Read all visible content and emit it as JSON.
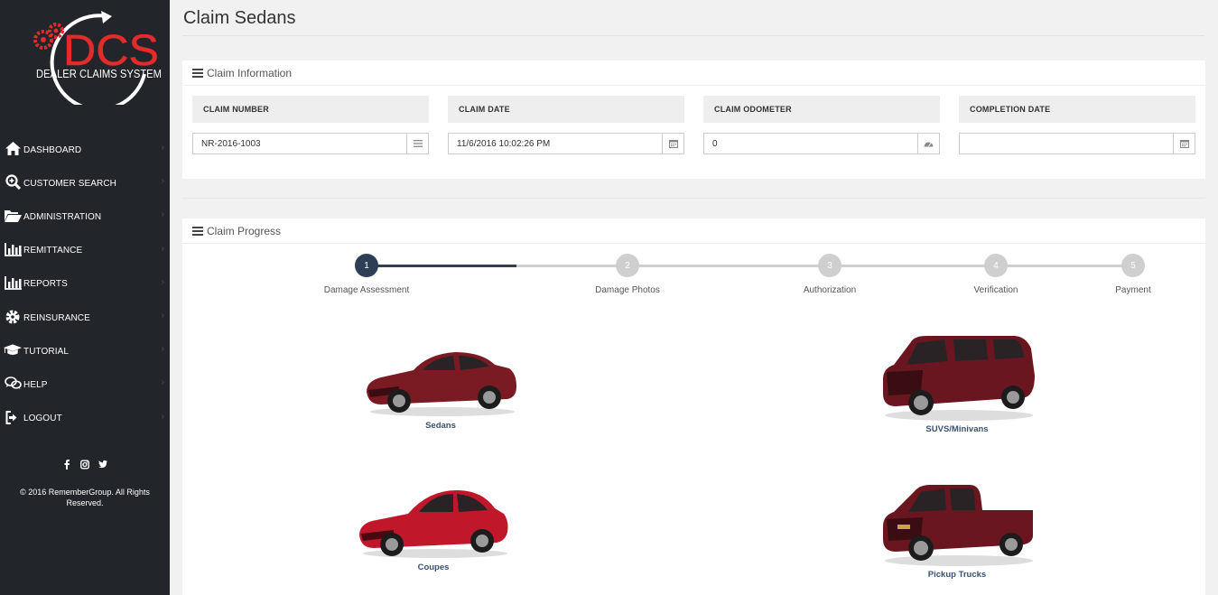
{
  "brand": {
    "logo_main": "DCS",
    "logo_sub": "DEALER CLAIMS SYSTEM",
    "accent_red": "#e32b2b"
  },
  "sidebar": {
    "items": [
      {
        "label": "DASHBOARD",
        "icon": "home-icon"
      },
      {
        "label": "CUSTOMER SEARCH",
        "icon": "search-plus-icon"
      },
      {
        "label": "ADMINISTRATION",
        "icon": "folder-open-icon"
      },
      {
        "label": "REMITTANCE",
        "icon": "bar-chart-icon"
      },
      {
        "label": "REPORTS",
        "icon": "bar-chart-icon"
      },
      {
        "label": "REINSURANCE",
        "icon": "gear-icon"
      },
      {
        "label": "TUTORIAL",
        "icon": "graduation-cap-icon"
      },
      {
        "label": "HELP",
        "icon": "chat-bubbles-icon"
      },
      {
        "label": "LOGOUT",
        "icon": "sign-out-icon"
      }
    ],
    "social": [
      "facebook-icon",
      "instagram-icon",
      "twitter-icon"
    ],
    "copyright": "© 2016 RememberGroup. All Rights Reserved."
  },
  "page": {
    "title": "Claim Sedans"
  },
  "claim_info": {
    "title": "Claim Information",
    "fields": [
      {
        "label": "CLAIM NUMBER",
        "value": "NR-2016-1003",
        "icon": "list-icon"
      },
      {
        "label": "CLAIM DATE",
        "value": "11/6/2016 10:02:26 PM",
        "icon": "calendar-icon"
      },
      {
        "label": "CLAIM ODOMETER",
        "value": "0",
        "icon": "dashboard-gauge-icon"
      },
      {
        "label": "COMPLETION DATE",
        "value": "",
        "icon": "calendar-icon"
      }
    ]
  },
  "claim_progress": {
    "title": "Claim Progress",
    "active_step": 1,
    "steps": [
      {
        "number": "1",
        "label": "Damage Assessment"
      },
      {
        "number": "2",
        "label": "Damage Photos"
      },
      {
        "number": "3",
        "label": "Authorization"
      },
      {
        "number": "4",
        "label": "Verification"
      },
      {
        "number": "5",
        "label": "Payment"
      }
    ],
    "active_color": "#2e3f55",
    "inactive_color": "#cfcfcf"
  },
  "vehicles": [
    {
      "label": "Sedans",
      "icon": "sedan-car-image"
    },
    {
      "label": "SUVS/Minivans",
      "icon": "suv-car-image"
    },
    {
      "label": "Coupes",
      "icon": "coupe-car-image"
    },
    {
      "label": "Pickup Trucks",
      "icon": "pickup-truck-image"
    }
  ]
}
